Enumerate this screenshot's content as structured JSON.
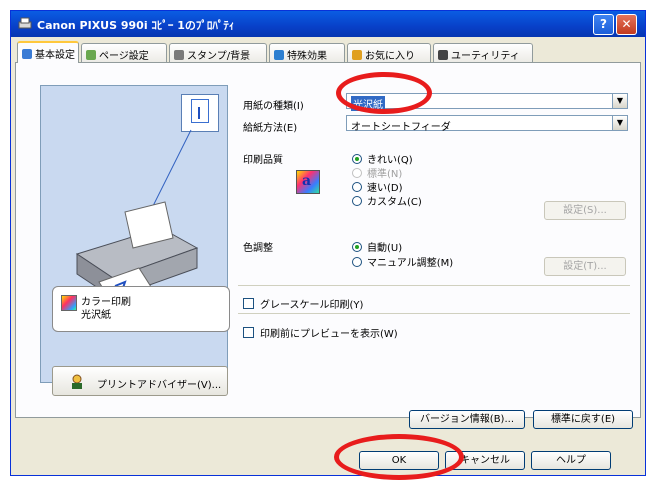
{
  "window": {
    "title": "Canon PIXUS 990i ｺﾋﾟｰ 1のﾌﾟﾛﾊﾟﾃｨ",
    "help_button": "?",
    "close_button": "✕"
  },
  "tabs": [
    {
      "label": "基本設定",
      "active": true,
      "icon_color": "#3a7bd5"
    },
    {
      "label": "ページ設定",
      "active": false,
      "icon_color": "#6aa84f"
    },
    {
      "label": "スタンプ/背景",
      "active": false,
      "icon_color": "#7a7a7a"
    },
    {
      "label": "特殊効果",
      "active": false,
      "icon_color": "#2d7fd0"
    },
    {
      "label": "お気に入り",
      "active": false,
      "icon_color": "#e0a020"
    },
    {
      "label": "ユーティリティ",
      "active": false,
      "icon_color": "#444444"
    }
  ],
  "preview": {
    "status_line1": "カラー印刷",
    "status_line2": "光沢紙"
  },
  "advisor_button": "プリントアドバイザー(V)...",
  "media": {
    "label": "用紙の種類(I)",
    "value": "光沢紙"
  },
  "paper_source": {
    "label": "給紙方法(E)",
    "value": "オートシートフィーダ"
  },
  "quality": {
    "label": "印刷品質",
    "options": [
      {
        "label": "きれい(Q)",
        "selected": true,
        "disabled": false
      },
      {
        "label": "標準(N)",
        "selected": false,
        "disabled": true
      },
      {
        "label": "速い(D)",
        "selected": false,
        "disabled": false
      },
      {
        "label": "カスタム(C)",
        "selected": false,
        "disabled": false
      }
    ],
    "settings_button": "設定(S)..."
  },
  "color_adjust": {
    "label": "色調整",
    "options": [
      {
        "label": "自動(U)",
        "selected": true
      },
      {
        "label": "マニュアル調整(M)",
        "selected": false
      }
    ],
    "settings_button": "設定(T)..."
  },
  "grayscale_check": "グレースケール印刷(Y)",
  "preview_check": "印刷前にプレビューを表示(W)",
  "version_button": "バージョン情報(B)...",
  "defaults_button": "標準に戻す(E)",
  "footer": {
    "ok": "OK",
    "cancel": "キャンセル",
    "help": "ヘルプ"
  },
  "colors": {
    "highlight": "#e81c1c",
    "title_bar": "#0a5de3"
  }
}
